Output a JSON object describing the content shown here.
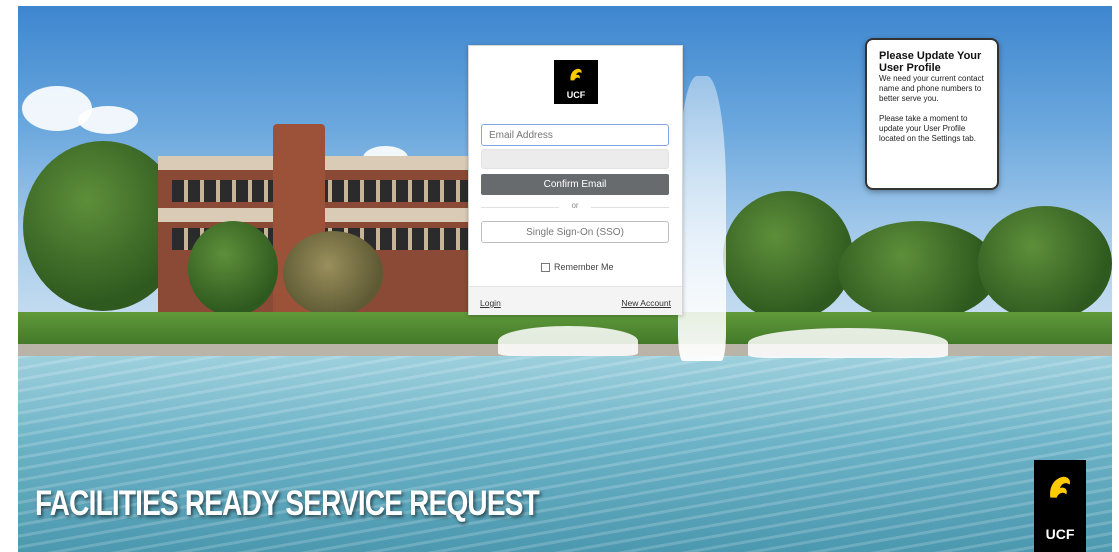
{
  "page": {
    "banner_title": "FACILITIES READY SERVICE REQUEST",
    "brand_text": "UCF"
  },
  "login": {
    "logo_text": "UCF",
    "email_placeholder": "Email Address",
    "confirm_label": "Confirm Email",
    "or_text": "or",
    "sso_label": "Single Sign-On (SSO)",
    "remember_label": "Remember Me",
    "login_link": "Login",
    "new_account_link": "New Account"
  },
  "notice": {
    "title": "Please Update Your User Profile",
    "body1": "We need your current contact name and phone numbers to better serve you.",
    "body2": "Please take a moment to update your User Profile located on the Settings tab."
  },
  "colors": {
    "ucf_gold": "#ffc904",
    "ucf_black": "#000000",
    "button_gray": "#686b6e",
    "input_focus": "#80a7e0"
  }
}
